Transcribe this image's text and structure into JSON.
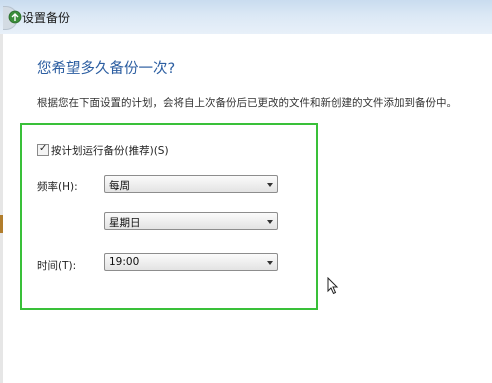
{
  "window": {
    "title": "设置备份"
  },
  "page": {
    "heading": "您希望多久备份一次?",
    "description": "根据您在下面设置的计划，会将自上次备份后已更改的文件和新创建的文件添加到备份中。"
  },
  "schedule": {
    "checkbox_label": "按计划运行备份(推荐)(S)",
    "checked": true,
    "frequency": {
      "label": "频率(H):",
      "value": "每周"
    },
    "day": {
      "value": "星期日"
    },
    "time": {
      "label": "时间(T):",
      "value": "19:00"
    }
  },
  "colors": {
    "heading": "#2c5ea1",
    "highlight_box": "#39c039"
  },
  "icons": {
    "app": "backup-icon",
    "back": "back-button-icon",
    "cursor": "mouse-pointer-icon"
  }
}
